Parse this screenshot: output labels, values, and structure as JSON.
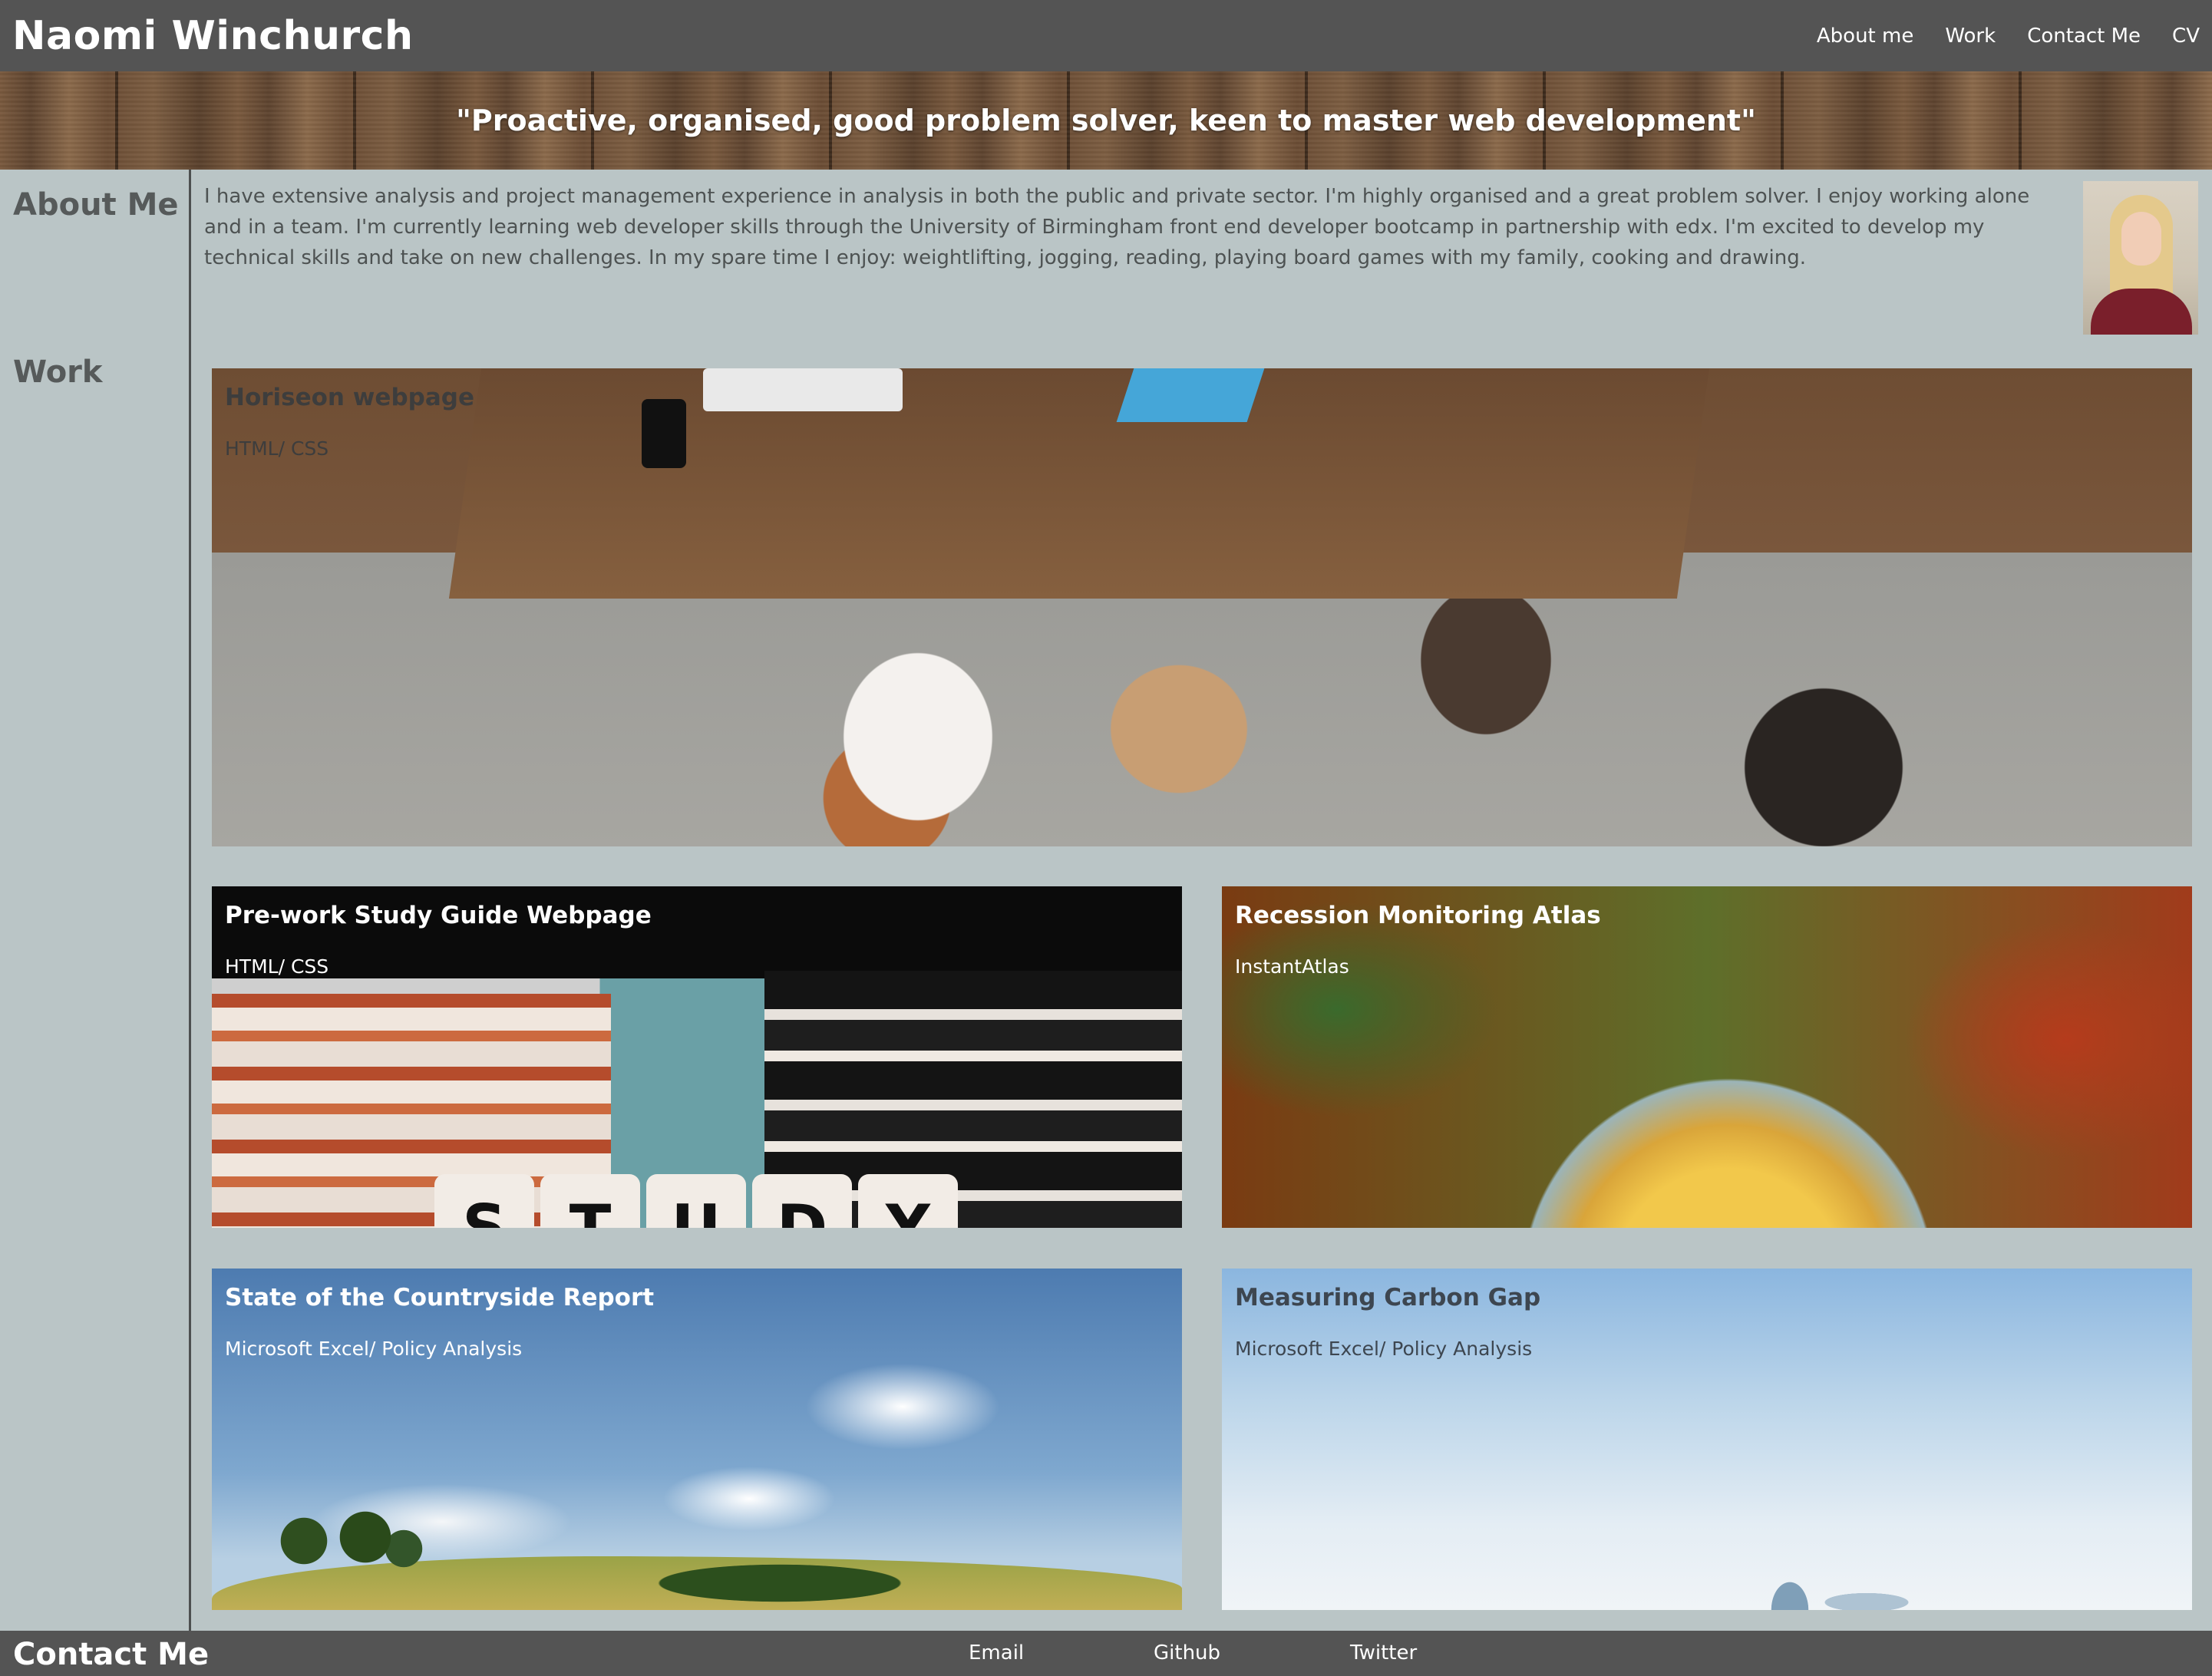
{
  "header": {
    "site_title": "Naomi Winchurch",
    "nav": [
      {
        "label": "About me"
      },
      {
        "label": "Work"
      },
      {
        "label": "Contact Me"
      },
      {
        "label": "CV"
      }
    ]
  },
  "banner": {
    "tagline": "\"Proactive, organised, good problem solver, keen to master web development\""
  },
  "about": {
    "heading": "About Me",
    "text": "I have extensive analysis and project management experience in analysis in both the public and private sector. I'm highly organised and a great problem solver. I enjoy working alone and in a team. I'm currently learning web developer skills through the University of Birmingham front end developer bootcamp in partnership with edx. I'm excited to develop my technical skills and take on new challenges. In my spare time I enjoy: weightlifting, jogging, reading, playing board games with my family, cooking and drawing."
  },
  "work": {
    "heading": "Work",
    "projects": [
      {
        "title": "Horiseon webpage",
        "tech": "HTML/ CSS"
      },
      {
        "title": "Pre-work Study Guide Webpage",
        "tech": "HTML/ CSS"
      },
      {
        "title": "Recession Monitoring Atlas",
        "tech": "InstantAtlas"
      },
      {
        "title": "State of the Countryside Report",
        "tech": "Microsoft Excel/ Policy Analysis"
      },
      {
        "title": "Measuring Carbon Gap",
        "tech": "Microsoft Excel/ Policy Analysis"
      }
    ],
    "dice_letters": [
      "S",
      "T",
      "U",
      "D",
      "Y"
    ]
  },
  "footer": {
    "heading": "Contact Me",
    "links": [
      {
        "label": "Email"
      },
      {
        "label": "Github"
      },
      {
        "label": "Twitter"
      }
    ]
  },
  "colors": {
    "background": "#bac5c6",
    "header_bar": "#545454",
    "text": "#4a4f4f"
  }
}
